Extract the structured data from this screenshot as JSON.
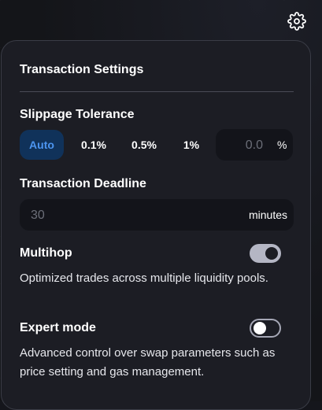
{
  "settings": {
    "title": "Transaction Settings",
    "slippage": {
      "label": "Slippage Tolerance",
      "options": [
        "Auto",
        "0.1%",
        "0.5%",
        "1%"
      ],
      "active": "Auto",
      "custom_placeholder": "0.0",
      "custom_value": "",
      "unit": "%"
    },
    "deadline": {
      "label": "Transaction Deadline",
      "placeholder": "30",
      "value": "",
      "unit": "minutes"
    },
    "multihop": {
      "label": "Multihop",
      "enabled": true,
      "description": "Optimized trades across multiple liquidity pools."
    },
    "expert": {
      "label": "Expert mode",
      "enabled": false,
      "description": "Advanced control over swap parameters such as price setting and gas management."
    }
  },
  "icons": {
    "settings": "gear-icon"
  },
  "colors": {
    "accent": "#4c95f0",
    "accent_bg": "#10325a",
    "panel": "#1c1d24"
  }
}
